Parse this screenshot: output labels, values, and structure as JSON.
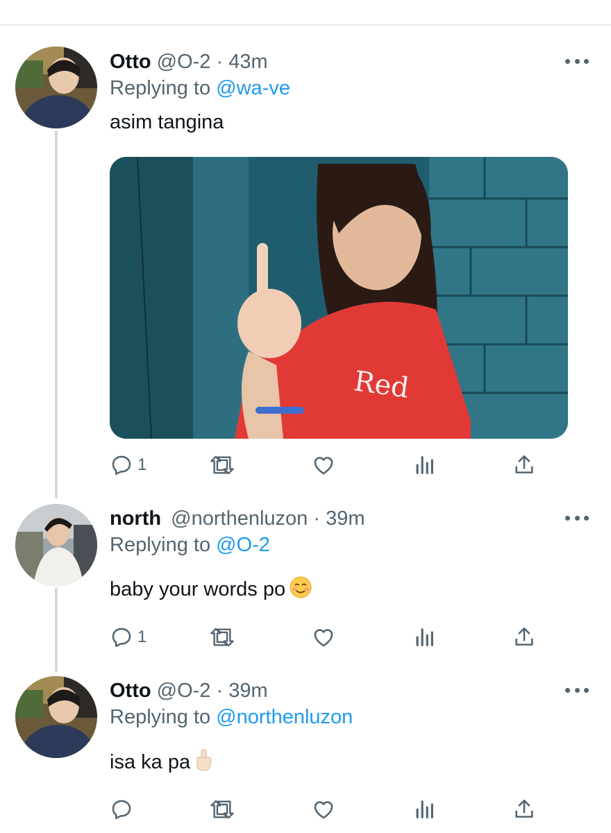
{
  "thread": [
    {
      "display_name": "Otto",
      "handle": "@O-2",
      "separator": "·",
      "time": "43m",
      "reply_prefix": "Replying to",
      "reply_to": "@wa-ve",
      "text": "asim tangina",
      "has_media": true,
      "actions": {
        "reply_count": "1",
        "retweet_count": "",
        "like_count": ""
      }
    },
    {
      "display_name": "north",
      "handle": "@northenluzon",
      "separator": "·",
      "time": "39m",
      "reply_prefix": "Replying to",
      "reply_to": "@O-2",
      "text": "baby your words po",
      "emoji": "smiling-face-emoji",
      "actions": {
        "reply_count": "1",
        "retweet_count": "",
        "like_count": ""
      }
    },
    {
      "display_name": "Otto",
      "handle": "@O-2",
      "separator": "·",
      "time": "39m",
      "reply_prefix": "Replying to",
      "reply_to": "@northenluzon",
      "text": "isa ka pa",
      "emoji": "hand-gesture-emoji",
      "actions": {
        "reply_count": "",
        "retweet_count": "",
        "like_count": ""
      }
    }
  ],
  "icons": {
    "reply": "reply-icon",
    "retweet": "retweet-icon",
    "like": "heart-icon",
    "analytics": "analytics-icon",
    "share": "share-icon",
    "more": "more-icon"
  },
  "colors": {
    "text_primary": "#0f1419",
    "text_secondary": "#536471",
    "accent": "#1d9bf0",
    "thread_line": "#cfd9de"
  }
}
